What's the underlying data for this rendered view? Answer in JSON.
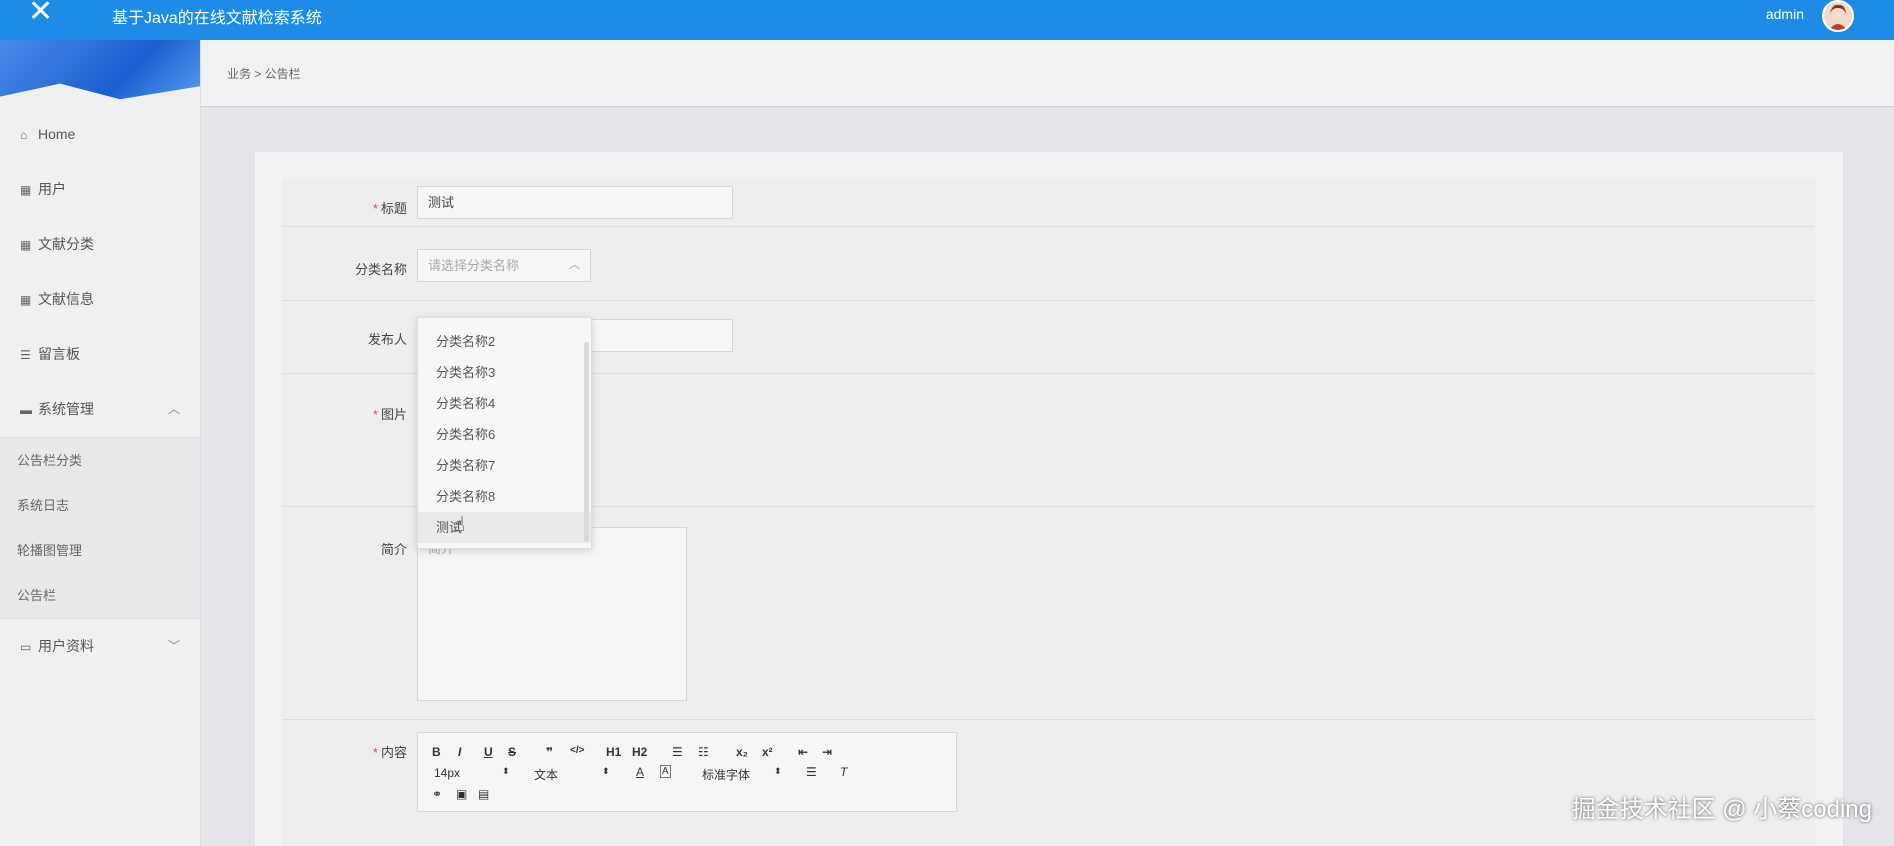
{
  "app": {
    "title": "基于Java的在线文献检索系统",
    "user": "admin"
  },
  "sidebar": {
    "items": [
      {
        "label": "Home",
        "icon": "home-icon"
      },
      {
        "label": "用户",
        "icon": "grid-icon"
      },
      {
        "label": "文献分类",
        "icon": "grid-icon"
      },
      {
        "label": "文献信息",
        "icon": "grid-icon"
      },
      {
        "label": "留言板",
        "icon": "list-icon"
      },
      {
        "label": "系统管理",
        "icon": "briefcase-icon"
      }
    ],
    "submenu": [
      "公告栏分类",
      "系统日志",
      "轮播图管理",
      "公告栏"
    ],
    "last": {
      "label": "用户资料",
      "icon": "card-icon"
    }
  },
  "breadcrumb": "业务 > 公告栏",
  "form": {
    "title_label": "标题",
    "title_value": "测试",
    "category_label": "分类名称",
    "category_placeholder": "请选择分类名称",
    "publisher_label": "发布人",
    "image_label": "图片",
    "intro_label": "简介",
    "intro_placeholder": "简介",
    "content_label": "内容"
  },
  "dropdown": {
    "options": [
      "分类名称2",
      "分类名称3",
      "分类名称4",
      "分类名称6",
      "分类名称7",
      "分类名称8",
      "测试"
    ]
  },
  "editor": {
    "toolbar_row1": [
      "B",
      "I",
      "U",
      "S",
      "❞",
      "</>",
      "H1",
      "H2",
      "☰",
      "☷",
      "x₂",
      "x²",
      "⇤",
      "⇥"
    ],
    "font_size": "14px",
    "text_style": "文本",
    "font_family": "标准字体"
  },
  "watermark": "掘金技术社区 @ 小蔡coding"
}
